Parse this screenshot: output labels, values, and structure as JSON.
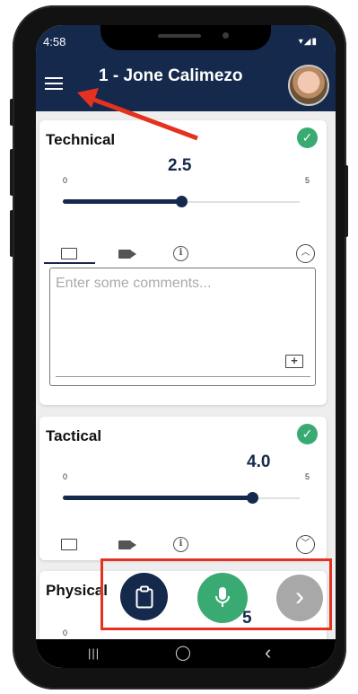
{
  "status_bar": {
    "time": "4:58",
    "icons": "▾◢▮"
  },
  "header": {
    "title": "1 - Jone Calimezo"
  },
  "cards": [
    {
      "title": "Technical",
      "value": "2.5",
      "slider": {
        "min": "0",
        "max": "5",
        "value": 2.5
      },
      "comment_placeholder": "Enter some comments...",
      "expanded": true
    },
    {
      "title": "Tactical",
      "value": "4.0",
      "slider": {
        "min": "0",
        "max": "5",
        "value": 4.0
      },
      "expanded": false
    },
    {
      "title": "Physical",
      "value_partial": "5",
      "tick_min_partial": "0"
    }
  ],
  "icons": {
    "menu": "menu-icon",
    "check": "✓",
    "chevron_up": "︿",
    "chevron_down": "﹀",
    "info": "i",
    "add_comment": "+",
    "next": "›"
  },
  "nav": {
    "recent": "|||",
    "home": "◯",
    "back": "‹"
  },
  "colors": {
    "appbar": "#15294d",
    "accent_green": "#3aaa73",
    "slider": "#15294d",
    "next_disabled": "#a8a8a8",
    "annotation_red": "#e5311f"
  }
}
